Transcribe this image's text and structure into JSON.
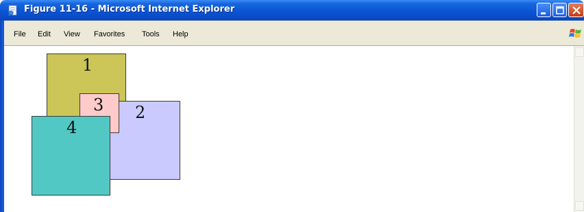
{
  "window": {
    "title": "Figure 11-16 - Microsoft Internet Explorer"
  },
  "menu": {
    "items": [
      {
        "label": "File"
      },
      {
        "label": "Edit"
      },
      {
        "label": "View"
      },
      {
        "label": "Favorites"
      },
      {
        "label": "Tools"
      },
      {
        "label": "Help"
      }
    ]
  },
  "boxes": [
    {
      "number": "1",
      "color": "#cbc657"
    },
    {
      "number": "2",
      "color": "#cacaff"
    },
    {
      "number": "3",
      "color": "#ffcaca"
    },
    {
      "number": "4",
      "color": "#52c8c4"
    }
  ],
  "icons": {
    "title": "ie-page-icon",
    "brand": "windows-flag-icon"
  },
  "colors": {
    "titlebar": "#0b55d5",
    "menubar": "#ece9d8"
  }
}
